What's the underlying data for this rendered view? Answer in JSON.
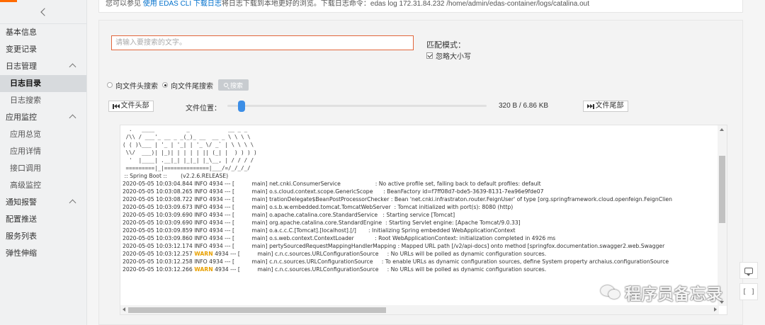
{
  "sidebar": {
    "items": [
      {
        "label": "基本信息",
        "sub": false,
        "active": false,
        "caret": false
      },
      {
        "label": "变更记录",
        "sub": false,
        "active": false,
        "caret": false
      },
      {
        "label": "日志管理",
        "sub": false,
        "active": false,
        "caret": true
      },
      {
        "label": "日志目录",
        "sub": true,
        "active": true,
        "caret": false
      },
      {
        "label": "日志搜索",
        "sub": true,
        "active": false,
        "caret": false
      },
      {
        "label": "应用监控",
        "sub": false,
        "active": false,
        "caret": true
      },
      {
        "label": "应用总览",
        "sub": true,
        "active": false,
        "caret": false
      },
      {
        "label": "应用详情",
        "sub": true,
        "active": false,
        "caret": false
      },
      {
        "label": "接口调用",
        "sub": true,
        "active": false,
        "caret": false
      },
      {
        "label": "高级监控",
        "sub": true,
        "active": false,
        "caret": false
      },
      {
        "label": "通知报警",
        "sub": false,
        "active": false,
        "caret": true
      },
      {
        "label": "配置推送",
        "sub": false,
        "active": false,
        "caret": false
      },
      {
        "label": "服务列表",
        "sub": false,
        "active": false,
        "caret": false
      },
      {
        "label": "弹性伸缩",
        "sub": false,
        "active": false,
        "caret": false
      }
    ]
  },
  "top_note": {
    "prefix": "您可以参见 ",
    "link": "使用 EDAS CLI 下载日志",
    "suffix": "将日志下载到本地更好的浏览。下载日志命令：edas log 172.31.84.232 /home/admin/edas-container/logs/catalina.out"
  },
  "search": {
    "placeholder": "请输入要搜索的文字。",
    "match_mode_label": "匹配模式：",
    "ignore_case_label": "忽略大小写",
    "ignore_case_checked": true,
    "radio_head_label": "向文件头搜索",
    "radio_tail_label": "向文件尾搜索",
    "radio_selected": "tail",
    "button_label": "搜索"
  },
  "file_nav": {
    "head_button": "文件头部",
    "tail_button": "文件尾部",
    "position_label": "文件位置：",
    "position_fraction": 0.04,
    "size_label": "320 B / 6.86 KB"
  },
  "log": {
    "banner": [
      "  .   ____          _            __ _ _",
      " /\\\\ / ___'_ __ _ _(_)_ __  __ _ \\ \\ \\ \\",
      "( ( )\\___ | '_ | '_| | '_ \\/ _` | \\ \\ \\ \\",
      " \\\\/  ___)| |_)| | | | | || (_| |  ) ) ) )",
      "  '  |____| .__|_| |_|_| |_\\__, | / / / /",
      " =========|_|==============|___/=/_/_/_/"
    ],
    "boot_line": " :: Spring Boot ::        (v2.2.6.RELEASE)",
    "lines": [
      {
        "ts": "2020-05-05 10:03:04.844",
        "level": "INFO",
        "pid": "4934 --- [",
        "thread": "main]",
        "msg": "net.cnki.ConsumerService                    : No active profile set, falling back to default profiles: default"
      },
      {
        "ts": "2020-05-05 10:03:08.265",
        "level": "INFO",
        "pid": "4934 --- [",
        "thread": "main]",
        "msg": "o.s.cloud.context.scope.GenericScope      : BeanFactory id=f7ff08d7-bde5-3639-8131-7ea96e9fde07"
      },
      {
        "ts": "2020-05-05 10:03:08.722",
        "level": "INFO",
        "pid": "4934 --- [",
        "thread": "main]",
        "msg": "trationDelegate$BeanPostProcessorChecker : Bean 'net.cnki.infrastraton.router.FeignUser' of type [org.springframework.cloud.openfeign.FeignClien"
      },
      {
        "ts": "2020-05-05 10:03:09.673",
        "level": "INFO",
        "pid": "4934 --- [",
        "thread": "main]",
        "msg": "o.s.b.w.embedded.tomcat.TomcatWebServer  : Tomcat initialized with port(s): 8080 (http)"
      },
      {
        "ts": "2020-05-05 10:03:09.690",
        "level": "INFO",
        "pid": "4934 --- [",
        "thread": "main]",
        "msg": "o.apache.catalina.core.StandardService   : Starting service [Tomcat]"
      },
      {
        "ts": "2020-05-05 10:03:09.690",
        "level": "INFO",
        "pid": "4934 --- [",
        "thread": "main]",
        "msg": "org.apache.catalina.core.StandardEngine  : Starting Servlet engine: [Apache Tomcat/9.0.33]"
      },
      {
        "ts": "2020-05-05 10:03:09.859",
        "level": "INFO",
        "pid": "4934 --- [",
        "thread": "main]",
        "msg": "o.a.c.c.C.[Tomcat].[localhost].[/]       : Initializing Spring embedded WebApplicationContext"
      },
      {
        "ts": "2020-05-05 10:03:09.860",
        "level": "INFO",
        "pid": "4934 --- [",
        "thread": "main]",
        "msg": "o.s.web.context.ContextLoader            : Root WebApplicationContext: initialization completed in 4926 ms"
      },
      {
        "ts": "2020-05-05 10:03:12.174",
        "level": "INFO",
        "pid": "4934 --- [",
        "thread": "main]",
        "msg": "pertySourcedRequestMappingHandlerMapping : Mapped URL path [/v2/api-docs] onto method [springfox.documentation.swagger2.web.Swagger"
      },
      {
        "ts": "2020-05-05 10:03:12.257",
        "level": "WARN",
        "pid": "4934 --- [",
        "thread": "main]",
        "msg": "c.n.c.sources.URLConfigurationSource     : No URLs will be polled as dynamic configuration sources."
      },
      {
        "ts": "2020-05-05 10:03:12.258",
        "level": "INFO",
        "pid": "4934 --- [",
        "thread": "main]",
        "msg": "c.n.c.sources.URLConfigurationSource     : To enable URLs as dynamic configuration sources, define System property archaius.configurationSource"
      },
      {
        "ts": "2020-05-05 10:03:12.266",
        "level": "WARN",
        "pid": "4934 --- [",
        "thread": "main]",
        "msg": "c.n.c.sources.URLConfigurationSource     : No URLs will be polled as dynamic configuration sources."
      }
    ]
  },
  "watermark": {
    "text": "程序员备忘录"
  },
  "colors": {
    "accent": "#ff6a00",
    "warn": "#e8a000",
    "link": "#0070cc",
    "slider": "#3c8ee6"
  }
}
